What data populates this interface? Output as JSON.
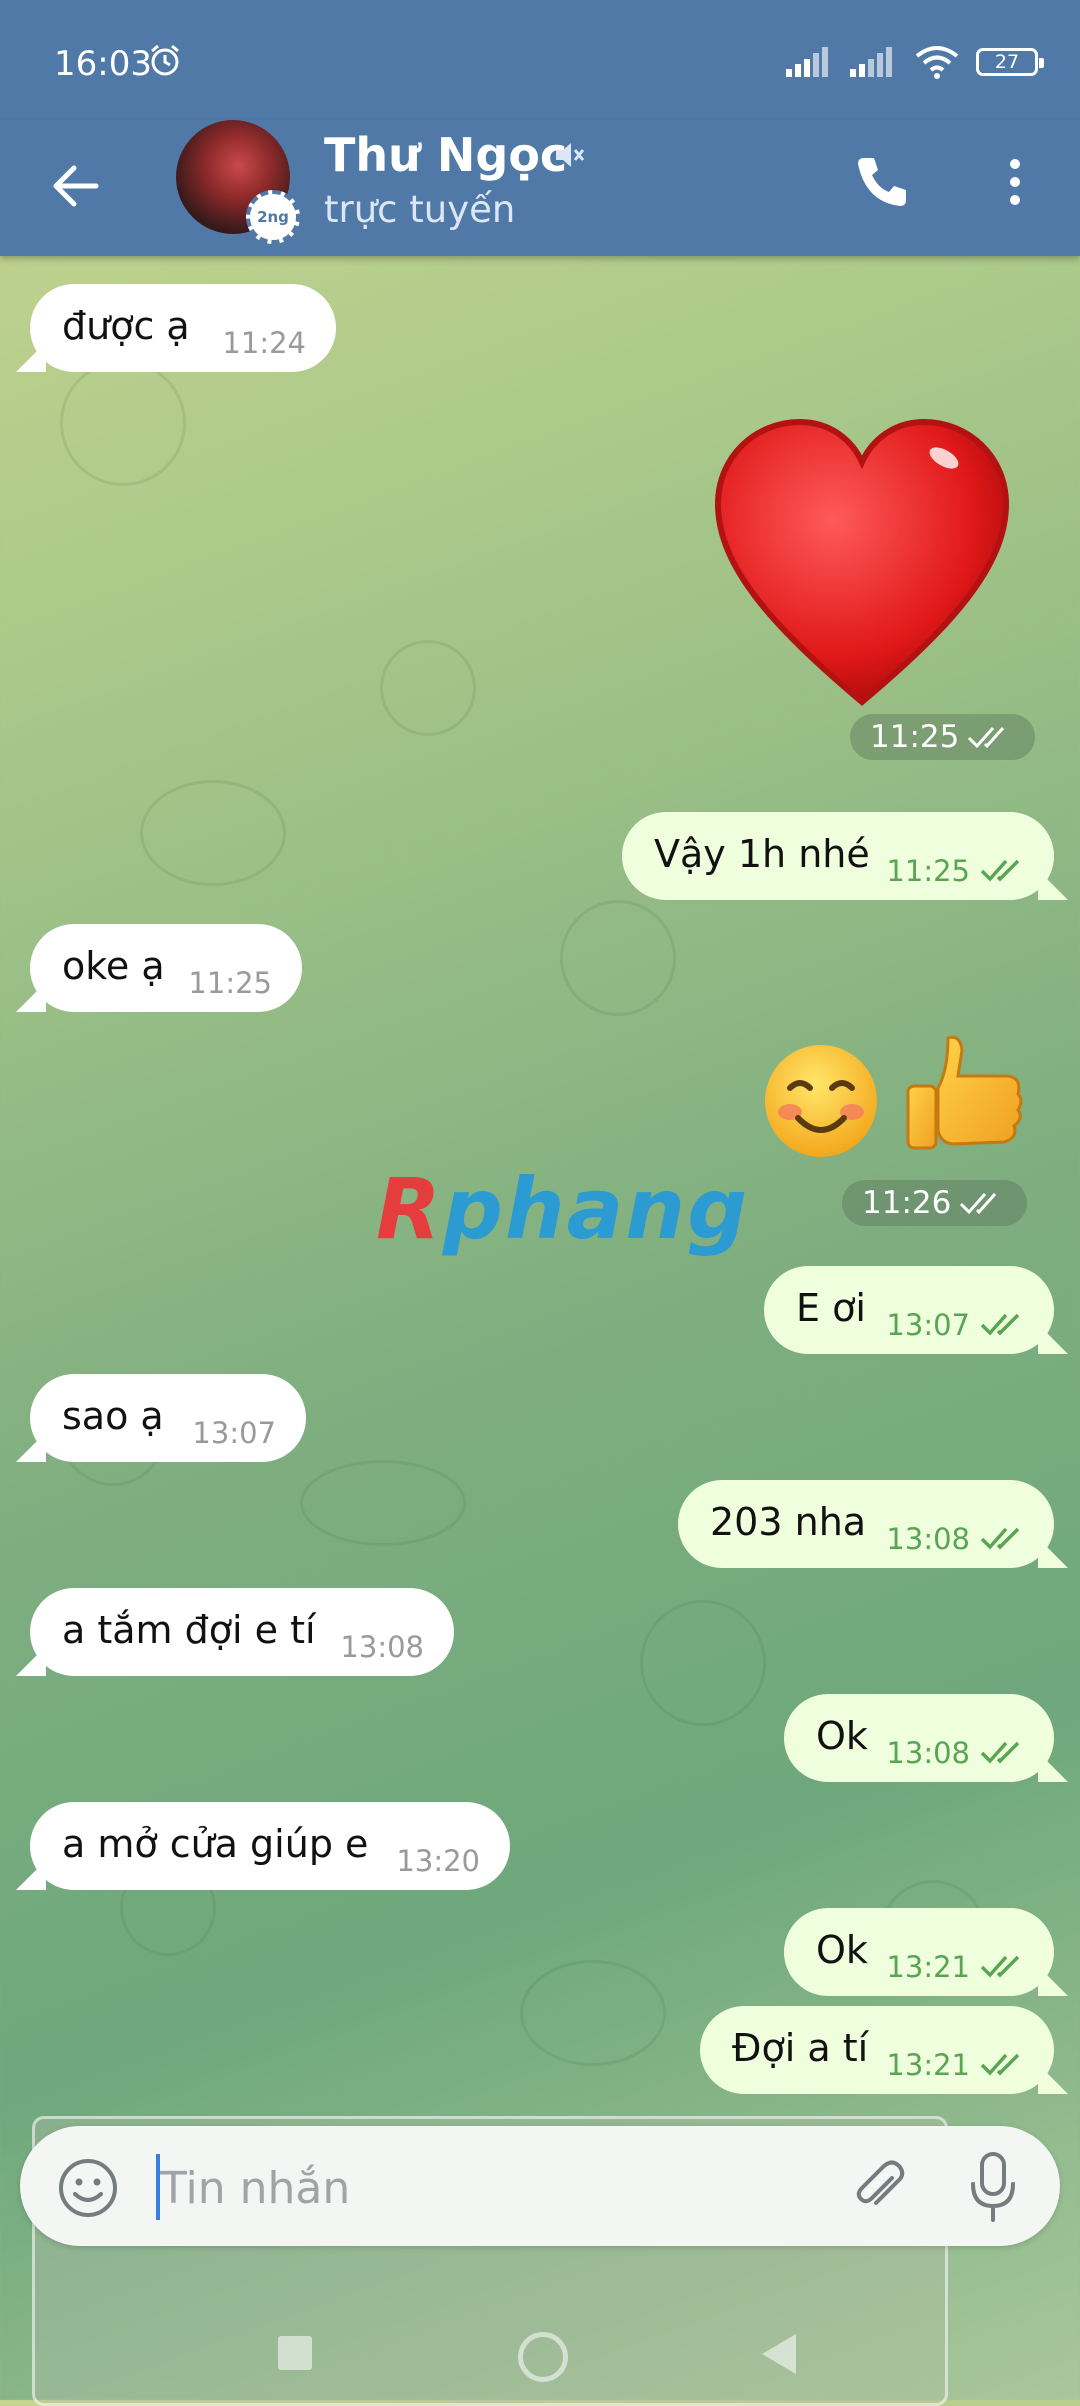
{
  "status_bar": {
    "time": "16:03",
    "battery": "27"
  },
  "header": {
    "contact_name": "Thư Ngọc",
    "contact_status": "trực tuyến",
    "story_badge": "2ng",
    "accent_color": "#5079a7"
  },
  "messages": [
    {
      "side": "in",
      "text": "được ạ",
      "time": "11:24"
    },
    {
      "side": "out",
      "type": "sticker",
      "sticker": "red-heart",
      "time": "11:25"
    },
    {
      "side": "out",
      "text": "Vậy 1h nhé",
      "time": "11:25"
    },
    {
      "side": "in",
      "text": "oke ạ",
      "time": "11:25"
    },
    {
      "side": "out",
      "type": "emoji",
      "emoji": [
        "smiling-face",
        "thumbs-up"
      ],
      "time": "11:26"
    },
    {
      "side": "out",
      "text": "E ơi",
      "time": "13:07"
    },
    {
      "side": "in",
      "text": "sao ạ",
      "time": "13:07"
    },
    {
      "side": "out",
      "text": "203 nha",
      "time": "13:08"
    },
    {
      "side": "in",
      "text": "a tắm đợi e tí",
      "time": "13:08"
    },
    {
      "side": "out",
      "text": "Ok",
      "time": "13:08"
    },
    {
      "side": "in",
      "text": "a mở cửa giúp e",
      "time": "13:20"
    },
    {
      "side": "out",
      "text": "Ok",
      "time": "13:21"
    },
    {
      "side": "out",
      "text": "Đợi a tí",
      "time": "13:21"
    }
  ],
  "watermark": {
    "first_letter": "R",
    "rest": "phang"
  },
  "composer": {
    "placeholder": "Tin nhắn"
  },
  "colors": {
    "outgoing_bubble": "#effedd",
    "incoming_bubble": "#ffffff",
    "read_check": "#5aa553"
  }
}
